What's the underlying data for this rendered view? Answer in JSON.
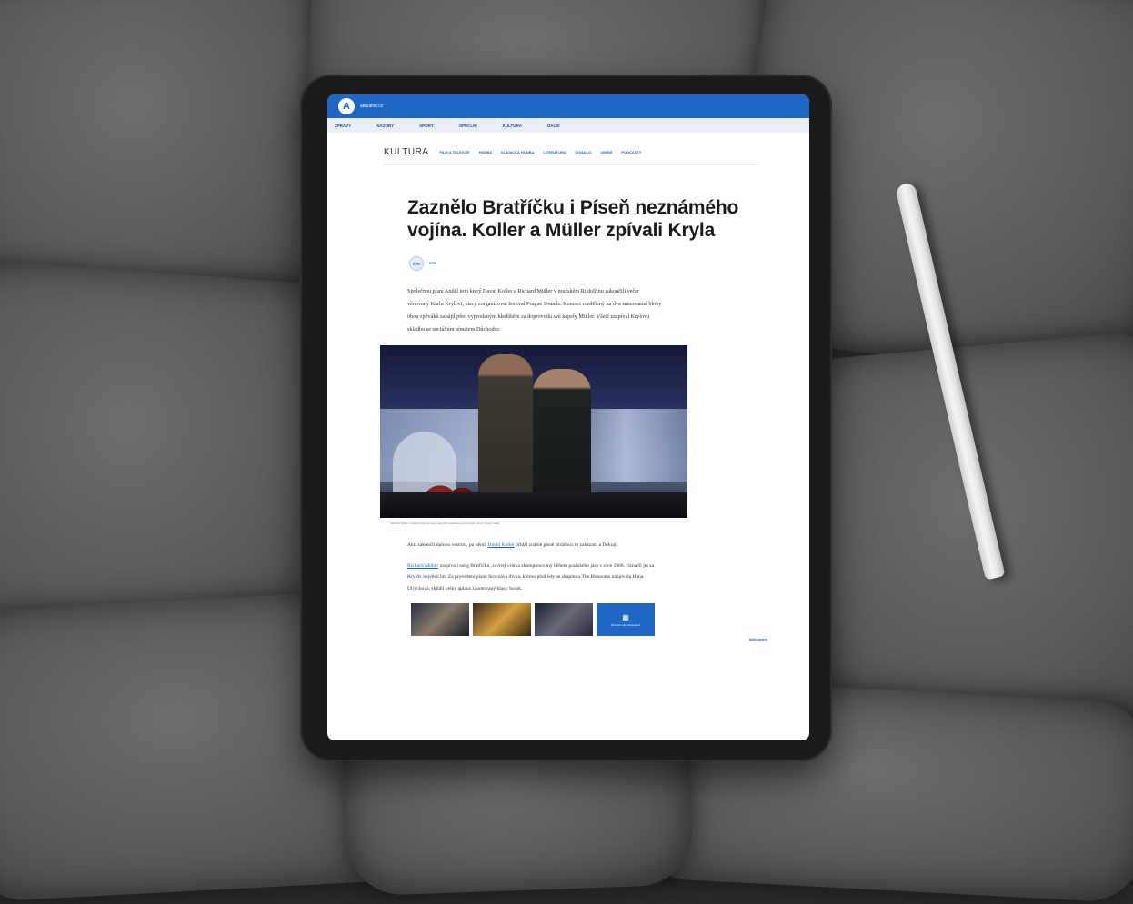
{
  "site": {
    "logo": "A",
    "name": "aktualne.cz"
  },
  "main_nav": [
    "ZPRÁVY",
    "NÁZORY",
    "SPORT",
    "OPEČLNÍ",
    "KULTURA",
    "DALŠÍ"
  ],
  "section": {
    "title": "KULTURA",
    "subnav": [
      "FILM A TELEVIZE",
      "HUDBA",
      "KLASICKÁ HUDBA",
      "LITERATURA",
      "DIVADLO",
      "UMĚNÍ",
      "PODCASTY"
    ]
  },
  "article": {
    "headline": "Zaznělo Bratříčku i Píseň neznámého vojína. Koller a Müller zpívali Kryla",
    "author_initials": "ČTK",
    "author": "ČTK",
    "lead": "Společnou písní Anděl toto který David Koller a Richard Müller v pražském Rudolfinu zakončili večer věnovaný Karlu Krylovi, který zorganizoval festival Prague Sounds. Koncert rozdělený na dva samostatné bloky obou zpěváků zahájil před vyprodaným hledištěm za doprovodu své kapely Müller. Všetě zazpíval Krylovu skladbu se sociálním tématem Důchodce.",
    "caption": "Richard Müller a David Koller koncert zakončili společnou písní Anděl. / Foto: Petra Vlašík",
    "body_1": "Aktí zakončil úplnou vestrou, po němž",
    "body_1_link": "David Koller",
    "body_1_tail": "přidal známé písně Stráčnici te zakázani a Děkuji.",
    "body_2_link": "Richard Müller",
    "body_2": "zazpívali song Bratříčku, zavírej vrátka zkomponovaný během pražského jara v roce 1968. Označil jej za Krylův největší hit. Za provedení písně Srovnává dívka, kterou před lety se skupinou The Blossoms nazpívala Hana Ulrychová, sklidil velký aplaus zanotovaný hlasy Sorok.",
    "aside": "Další zprávy",
    "gallery_label": "Zobrazit celou fotogalerii"
  }
}
